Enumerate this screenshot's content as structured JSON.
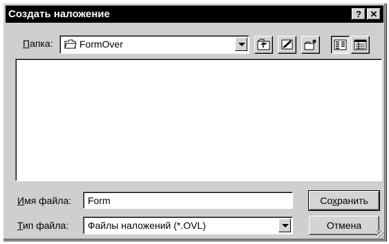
{
  "window": {
    "title": "Создать наложение",
    "help_label": "?",
    "close_label": "✕"
  },
  "folder": {
    "label_accel": "П",
    "label_rest": "апка:",
    "value": "FormOver"
  },
  "toolbar": {
    "icons": [
      "up-folder-icon",
      "desktop-icon",
      "new-folder-icon",
      "list-view-icon",
      "details-view-icon"
    ]
  },
  "filename": {
    "label_accel": "И",
    "label_rest": "мя файла:",
    "value": "Form"
  },
  "filetype": {
    "label_accel": "Т",
    "label_rest": "ип файла:",
    "value": "Файлы наложений (*.OVL)"
  },
  "buttons": {
    "save_pre": "Со",
    "save_accel": "х",
    "save_post": "ранить",
    "cancel": "Отмена"
  }
}
